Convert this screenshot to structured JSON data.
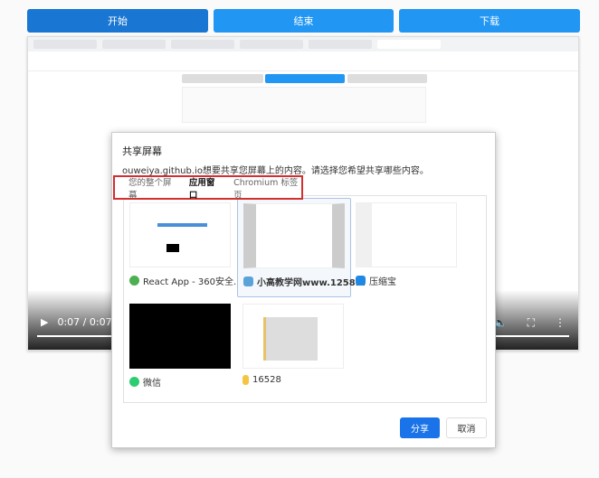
{
  "top_buttons": {
    "start": "开始",
    "stop": "结束",
    "download": "下载"
  },
  "video": {
    "time": "0:07 / 0:07",
    "progress": 1.0
  },
  "dialog": {
    "title": "共享屏幕",
    "message": "ouweiya.github.io想要共享您屏幕上的内容。请选择您希望共享哪些内容。",
    "tabs": [
      {
        "label": "您的整个屏幕"
      },
      {
        "label": "应用窗口"
      },
      {
        "label": "Chromium 标签页"
      }
    ],
    "selected_tab": "应用窗口",
    "windows": [
      {
        "label": "React App - 360安全...",
        "icon": "360-browser-icon"
      },
      {
        "label": "小高教学网www.1258...",
        "icon": "notepad-icon"
      },
      {
        "label": "压缩宝",
        "icon": "compress-app-icon"
      },
      {
        "label": "微信",
        "icon": "wechat-icon"
      },
      {
        "label": "16528",
        "icon": "folder-icon"
      }
    ],
    "share": "分享",
    "cancel": "取消"
  },
  "colors": {
    "primary": "#2196f3",
    "primary_dark": "#1976d2",
    "highlight": "#d32f2f"
  }
}
